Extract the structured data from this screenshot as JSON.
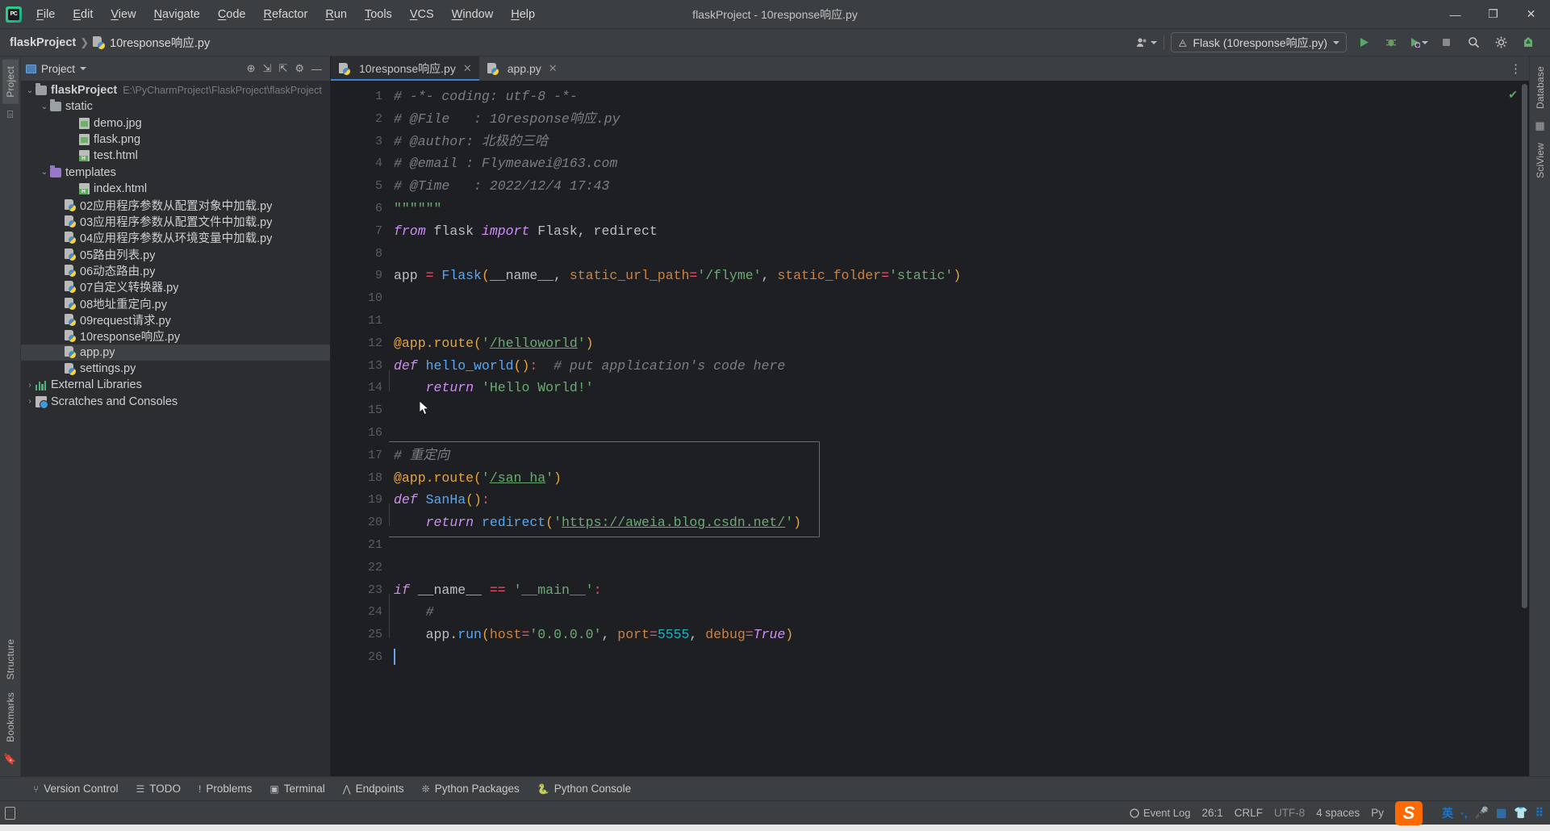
{
  "window": {
    "title": "flaskProject - 10response响应.py",
    "controls": {
      "minimize": "—",
      "maximize": "❐",
      "close": "✕"
    }
  },
  "menubar": {
    "items": [
      "File",
      "Edit",
      "View",
      "Navigate",
      "Code",
      "Refactor",
      "Run",
      "Tools",
      "VCS",
      "Window",
      "Help"
    ]
  },
  "navbar": {
    "breadcrumb": {
      "project": "flaskProject",
      "separator": "❯",
      "file": "10response响应.py"
    },
    "run_config": {
      "label": "Flask (10response响应.py)"
    },
    "icons": {
      "account": "account-icon",
      "run": "▶",
      "debug": "debug-icon",
      "coverage": "coverage-icon",
      "stop": "■",
      "search": "search-icon",
      "settings": "gear-icon",
      "updates": "updates-icon"
    }
  },
  "left_rail": {
    "tabs": [
      "Project"
    ],
    "bottom_tabs": [
      "Structure",
      "Bookmarks"
    ]
  },
  "right_rail": {
    "tabs": [
      "Database",
      "SciView"
    ]
  },
  "project_panel": {
    "title": "Project",
    "header_icons": [
      "locate-icon",
      "collapse-icon",
      "expand-icon",
      "gear-icon",
      "hide-icon"
    ],
    "tree": [
      {
        "label": "flaskProject",
        "sub": "E:\\PyCharmProject\\FlaskProject\\flaskProject",
        "icon": "folder",
        "indent": 0,
        "arrow": "down",
        "bold": true,
        "selected": false
      },
      {
        "label": "static",
        "sub": "",
        "icon": "folder",
        "indent": 1,
        "arrow": "down",
        "bold": false,
        "selected": false
      },
      {
        "label": "demo.jpg",
        "sub": "",
        "icon": "image",
        "indent": 3,
        "arrow": "",
        "bold": false,
        "selected": false
      },
      {
        "label": "flask.png",
        "sub": "",
        "icon": "image",
        "indent": 3,
        "arrow": "",
        "bold": false,
        "selected": false
      },
      {
        "label": "test.html",
        "sub": "",
        "icon": "html",
        "indent": 3,
        "arrow": "",
        "bold": false,
        "selected": false
      },
      {
        "label": "templates",
        "sub": "",
        "icon": "folder-purple",
        "indent": 1,
        "arrow": "down",
        "bold": false,
        "selected": false
      },
      {
        "label": "index.html",
        "sub": "",
        "icon": "html",
        "indent": 3,
        "arrow": "",
        "bold": false,
        "selected": false
      },
      {
        "label": "02应用程序参数从配置对象中加载.py",
        "sub": "",
        "icon": "python",
        "indent": 2,
        "arrow": "",
        "bold": false,
        "selected": false
      },
      {
        "label": "03应用程序参数从配置文件中加载.py",
        "sub": "",
        "icon": "python",
        "indent": 2,
        "arrow": "",
        "bold": false,
        "selected": false
      },
      {
        "label": "04应用程序参数从环境变量中加载.py",
        "sub": "",
        "icon": "python",
        "indent": 2,
        "arrow": "",
        "bold": false,
        "selected": false
      },
      {
        "label": "05路由列表.py",
        "sub": "",
        "icon": "python",
        "indent": 2,
        "arrow": "",
        "bold": false,
        "selected": false
      },
      {
        "label": "06动态路由.py",
        "sub": "",
        "icon": "python",
        "indent": 2,
        "arrow": "",
        "bold": false,
        "selected": false
      },
      {
        "label": "07自定义转换器.py",
        "sub": "",
        "icon": "python",
        "indent": 2,
        "arrow": "",
        "bold": false,
        "selected": false
      },
      {
        "label": "08地址重定向.py",
        "sub": "",
        "icon": "python",
        "indent": 2,
        "arrow": "",
        "bold": false,
        "selected": false
      },
      {
        "label": "09request请求.py",
        "sub": "",
        "icon": "python",
        "indent": 2,
        "arrow": "",
        "bold": false,
        "selected": false
      },
      {
        "label": "10response响应.py",
        "sub": "",
        "icon": "python",
        "indent": 2,
        "arrow": "",
        "bold": false,
        "selected": false
      },
      {
        "label": "app.py",
        "sub": "",
        "icon": "python",
        "indent": 2,
        "arrow": "",
        "bold": false,
        "selected": true
      },
      {
        "label": "settings.py",
        "sub": "",
        "icon": "python",
        "indent": 2,
        "arrow": "",
        "bold": false,
        "selected": false
      },
      {
        "label": "External Libraries",
        "sub": "",
        "icon": "library",
        "indent": 0,
        "arrow": "right",
        "bold": false,
        "selected": false
      },
      {
        "label": "Scratches and Consoles",
        "sub": "",
        "icon": "scratch",
        "indent": 0,
        "arrow": "right",
        "bold": false,
        "selected": false
      }
    ]
  },
  "editor": {
    "tabs": [
      {
        "label": "10response响应.py",
        "active": true,
        "close": "✕"
      },
      {
        "label": "app.py",
        "active": false,
        "close": "✕"
      }
    ],
    "first_line": 1,
    "lines": [
      {
        "n": 1,
        "text": "# -*- coding: utf-8 -*-"
      },
      {
        "n": 2,
        "text": "# @File   : 10response响应.py"
      },
      {
        "n": 3,
        "text": "# @author: 北极的三哈"
      },
      {
        "n": 4,
        "text": "# @email : Flymeawei@163.com"
      },
      {
        "n": 5,
        "text": "# @Time   : 2022/12/4 17:43"
      },
      {
        "n": 6,
        "text": "\"\"\"\"\"\""
      },
      {
        "n": 7,
        "text": "from flask import Flask, redirect"
      },
      {
        "n": 8,
        "text": ""
      },
      {
        "n": 9,
        "text": "app = Flask(__name__, static_url_path='/flyme', static_folder='static')"
      },
      {
        "n": 10,
        "text": ""
      },
      {
        "n": 11,
        "text": ""
      },
      {
        "n": 12,
        "text": "@app.route('/helloworld')"
      },
      {
        "n": 13,
        "text": "def hello_world():  # put application's code here"
      },
      {
        "n": 14,
        "text": "    return 'Hello World!'"
      },
      {
        "n": 15,
        "text": ""
      },
      {
        "n": 16,
        "text": ""
      },
      {
        "n": 17,
        "text": "# 重定向"
      },
      {
        "n": 18,
        "text": "@app.route('/san_ha')"
      },
      {
        "n": 19,
        "text": "def SanHa():"
      },
      {
        "n": 20,
        "text": "    return redirect('https://aweia.blog.csdn.net/')"
      },
      {
        "n": 21,
        "text": ""
      },
      {
        "n": 22,
        "text": ""
      },
      {
        "n": 23,
        "text": "if __name__ == '__main__':"
      },
      {
        "n": 24,
        "text": "    #"
      },
      {
        "n": 25,
        "text": "    app.run(host='0.0.0.0', port=5555, debug=True)"
      },
      {
        "n": 26,
        "text": ""
      }
    ],
    "highlight_box": {
      "from_line": 17,
      "to_line": 20,
      "color": "#e53935"
    },
    "inspection_status": "✔"
  },
  "tool_window_bar": {
    "items": [
      {
        "label": "Version Control",
        "icon": "branch-icon"
      },
      {
        "label": "TODO",
        "icon": "list-icon"
      },
      {
        "label": "Problems",
        "icon": "warning-icon"
      },
      {
        "label": "Terminal",
        "icon": "terminal-icon"
      },
      {
        "label": "Endpoints",
        "icon": "endpoints-icon"
      },
      {
        "label": "Python Packages",
        "icon": "packages-icon"
      },
      {
        "label": "Python Console",
        "icon": "python-icon"
      }
    ]
  },
  "status_bar": {
    "caret_position": "26:1",
    "line_separator": "CRLF",
    "encoding": "UTF-8",
    "indent": "4 spaces",
    "interpreter": "Py",
    "event_log": "Event Log",
    "tray": {
      "ime": "英",
      "punctuation": "·,",
      "mic": "mic-icon",
      "keyboard": "keyboard-icon",
      "skin": "shirt-icon",
      "apps": "apps-icon",
      "sogou": "S"
    }
  },
  "colors": {
    "accent": "#3b82d8",
    "editor_bg": "#1e1f22",
    "panel_bg": "#2b2d30",
    "chrome_bg": "#3c3f41",
    "highlight": "#e53935",
    "green": "#59a869"
  }
}
